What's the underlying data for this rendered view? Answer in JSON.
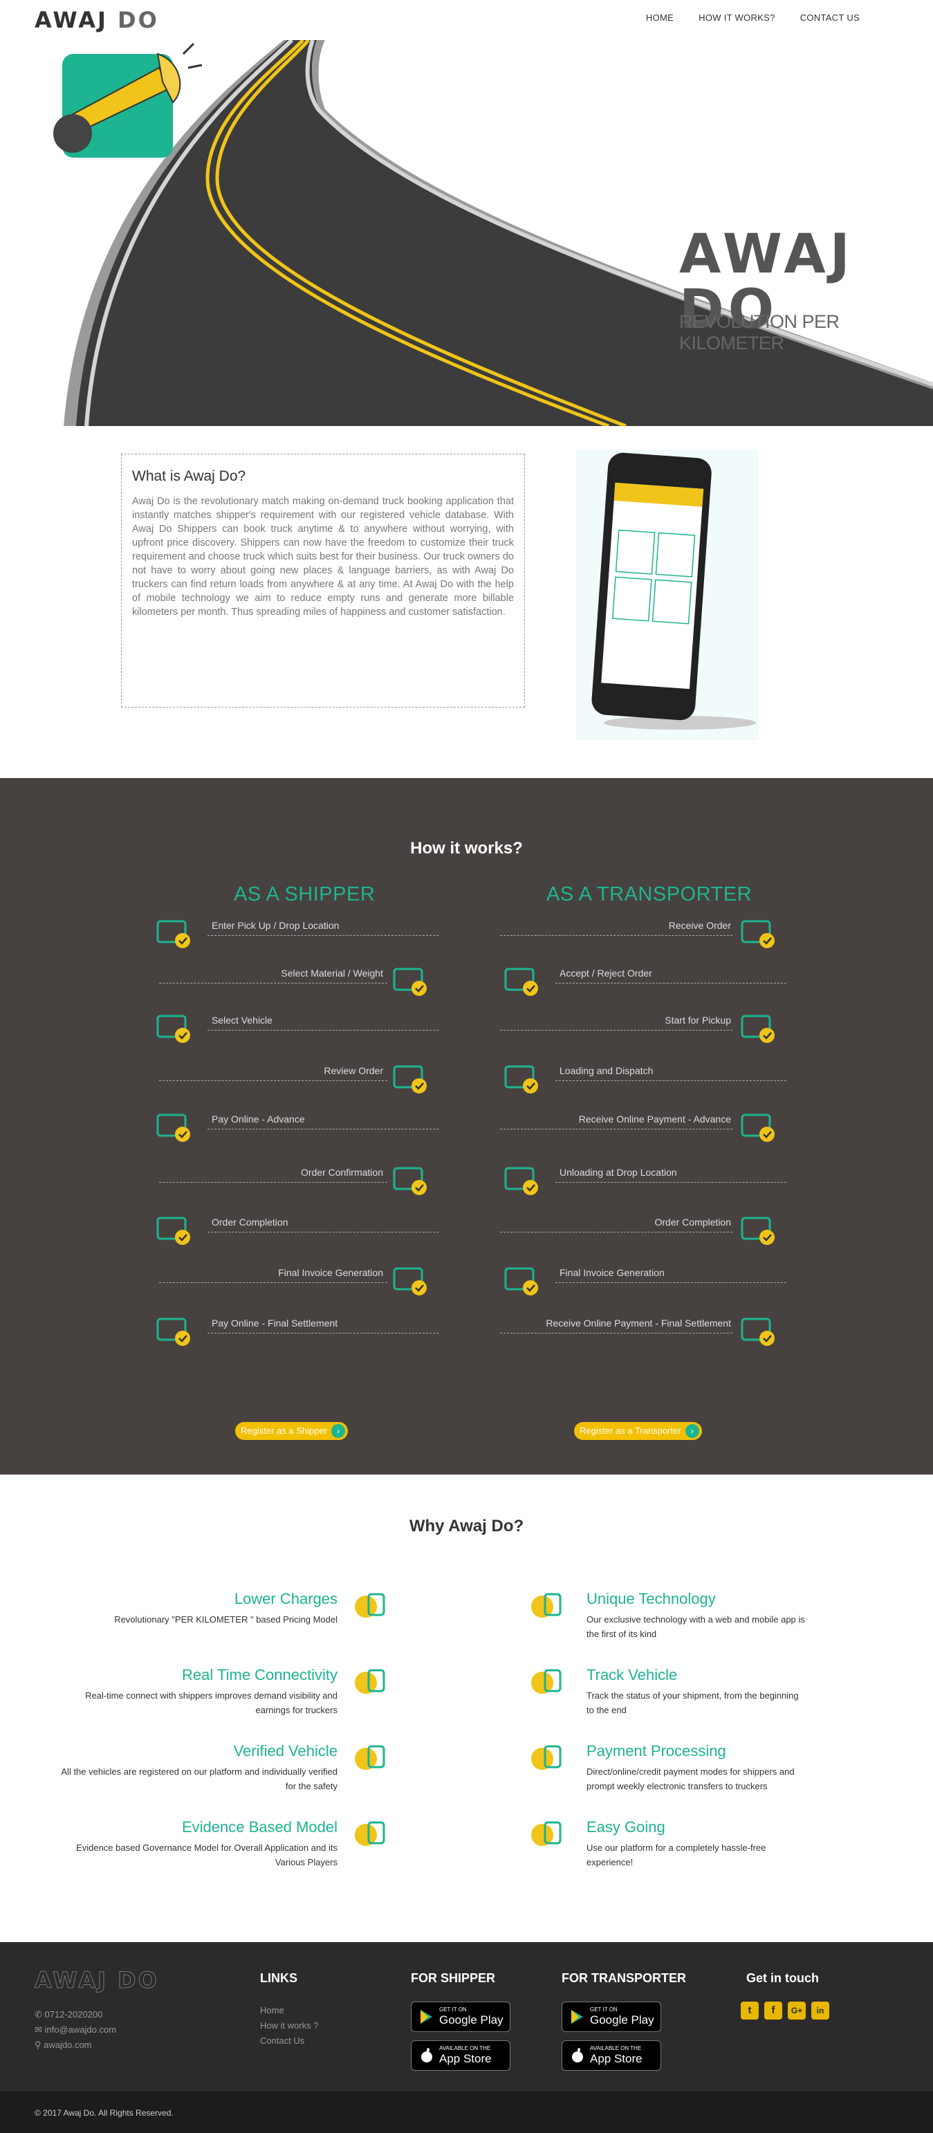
{
  "header": {
    "logo_a": "AWAJ",
    "logo_b": "DO",
    "nav": [
      "HOME",
      "HOW IT WORKS?",
      "CONTACT US"
    ]
  },
  "hero": {
    "brand_name": "AWAJ DO",
    "tagline": "REVOLUTION PER KILOMETER"
  },
  "about": {
    "title": "What is Awaj Do?",
    "body": "Awaj Do is the revolutionary match making on-demand truck booking application that instantly matches shipper's requirement with our registered vehicle database. With Awaj Do Shippers can book truck anytime & to anywhere without worrying, with upfront price discovery. Shippers can now have the freedom to customize their truck requirement and choose truck which suits best for their business. Our truck owners do not have to worry about going new places & language barriers, as with Awaj Do truckers can find return loads from anywhere & at any time. At Awaj Do with the help of mobile technology we aim to reduce empty runs and generate more billable kilometers per month. Thus spreading miles of happiness and customer satisfaction."
  },
  "how": {
    "title": "How it works?",
    "shipper_title": "AS A SHIPPER",
    "transporter_title": "AS A TRANSPORTER",
    "shipper_steps": [
      {
        "label": "Enter Pick Up / Drop Location",
        "icon": "location-truck-icon"
      },
      {
        "label": "Select Material / Weight",
        "icon": "weighing-scale-icon"
      },
      {
        "label": "Select Vehicle",
        "icon": "trucks-icon"
      },
      {
        "label": "Review Order",
        "icon": "cart-check-icon"
      },
      {
        "label": "Pay Online - Advance",
        "icon": "card-payment-icon"
      },
      {
        "label": "Order Confirmation",
        "icon": "handshake-icon"
      },
      {
        "label": "Order Completion",
        "icon": "document-check-icon"
      },
      {
        "label": "Final Invoice Generation",
        "icon": "invoice-monitor-icon"
      },
      {
        "label": "Pay Online - Final Settlement",
        "icon": "mobile-transfer-icon"
      }
    ],
    "transporter_steps": [
      {
        "label": "Receive Order",
        "icon": "box-check-icon"
      },
      {
        "label": "Accept / Reject Order",
        "icon": "boxes-accept-reject-icon"
      },
      {
        "label": "Start for Pickup",
        "icon": "flag-truck-icon"
      },
      {
        "label": "Loading and Dispatch",
        "icon": "moving-truck-icon"
      },
      {
        "label": "Receive Online Payment - Advance",
        "icon": "monitor-payment-icon"
      },
      {
        "label": "Unloading at Drop Location",
        "icon": "unloading-truck-icon"
      },
      {
        "label": "Order Completion",
        "icon": "document-check-icon"
      },
      {
        "label": "Final Invoice Generation",
        "icon": "invoice-monitor-icon"
      },
      {
        "label": "Receive Online Payment - Final Settlement",
        "icon": "mobile-transfer-icon"
      }
    ],
    "register_shipper": "Register as a Shipper",
    "register_transporter": "Register as a Transporter"
  },
  "why": {
    "title": "Why Awaj Do?",
    "features": [
      {
        "title": "Lower Charges",
        "text": "Revolutionary \"PER KILOMETER \" based Pricing Model",
        "icon": "money-hand-icon"
      },
      {
        "title": "Unique Technology",
        "text": "Our exclusive technology with a web and mobile app is the first of its kind",
        "icon": "gears-icon"
      },
      {
        "title": "Real Time Connectivity",
        "text": "Real-time connect with shippers improves demand visibility and earnings for truckers",
        "icon": "mobile-touch-icon"
      },
      {
        "title": "Track Vehicle",
        "text": "Track the status of your shipment, from the beginning to the end",
        "icon": "pin-truck-icon"
      },
      {
        "title": "Verified Vehicle",
        "text": "All the vehicles are registered on our platform and individually verified for the safety",
        "icon": "shield-check-icon"
      },
      {
        "title": "Payment Processing",
        "text": "Direct/online/credit payment modes for shippers and prompt weekly electronic transfers to truckers",
        "icon": "credit-card-icon"
      },
      {
        "title": "Evidence Based Model",
        "text": "Evidence based Governance Model for Overall Application and its Various Players",
        "icon": "magnifier-eye-icon"
      },
      {
        "title": "Easy Going",
        "text": "Use our platform for a completely hassle-free experience!",
        "icon": "thumbs-up-icon"
      }
    ]
  },
  "footer": {
    "logo": "AWAJ DO",
    "phone": "0712-2020200",
    "email": "info@awajdo.com",
    "site": "awajdo.com",
    "links_title": "LINKS",
    "links": [
      "Home",
      "How it works ?",
      "Contact Us"
    ],
    "shipper_title": "FOR SHIPPER",
    "transporter_title": "FOR TRANSPORTER",
    "touch_title": "Get in touch",
    "gplay_small": "GET IT ON",
    "gplay_big": "Google Play",
    "appstore_small": "Available on the",
    "appstore_big": "App Store",
    "copyright": "© 2017 Awaj Do. All Rights Reserved."
  },
  "colors": {
    "accent": "#1db491",
    "yellow": "#f2c000",
    "dark": "#47423f"
  }
}
